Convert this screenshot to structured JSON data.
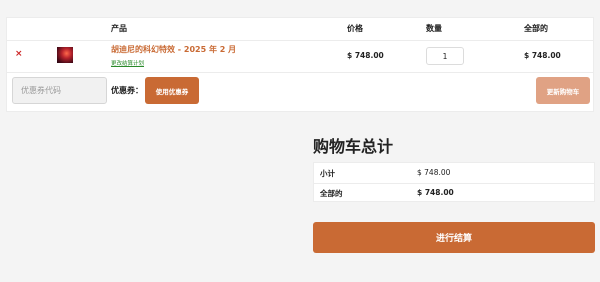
{
  "cart": {
    "headers": {
      "product": "产品",
      "price": "价格",
      "quantity": "数量",
      "total": "全部的"
    },
    "items": [
      {
        "remove": "×",
        "name": "胡迪尼的科幻特效 - 2025 年 2 月",
        "meta": "更改结算计划",
        "price": "$ 748.00",
        "quantity": "1",
        "total": "$ 748.00"
      }
    ],
    "coupon": {
      "placeholder": "优惠券代码",
      "label": "优惠券：",
      "apply_label": "使用优惠券"
    },
    "update_label": "更新购物车"
  },
  "totals": {
    "title": "购物车总计",
    "subtotal_label": "小计",
    "subtotal_value": "$ 748.00",
    "total_label": "全部的",
    "total_value": "$ 748.00",
    "checkout_label": "进行结算"
  },
  "colors": {
    "accent": "#c96a34",
    "accent_light": "#e0a284",
    "remove": "#cc2222",
    "meta_link": "#2a8a2a"
  }
}
